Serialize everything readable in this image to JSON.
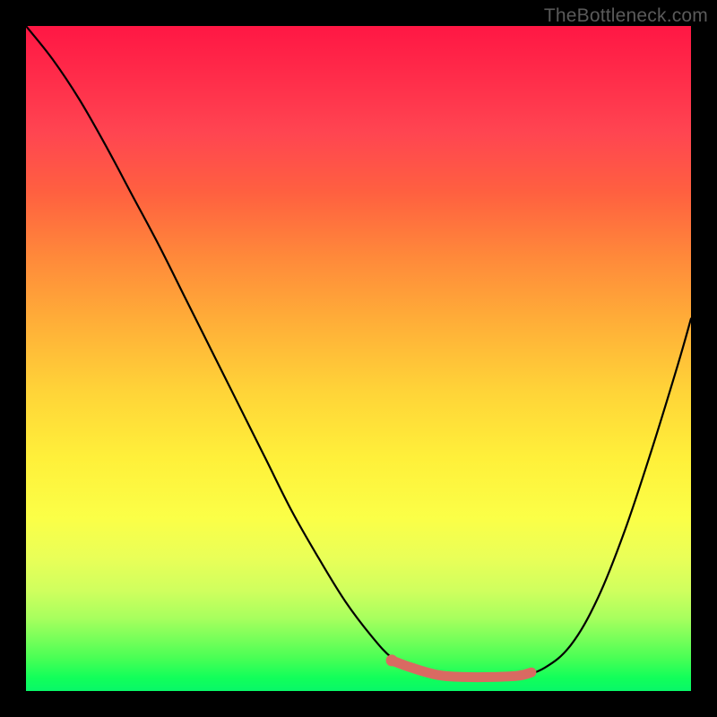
{
  "watermark": "TheBottleneck.com",
  "colors": {
    "background": "#000000",
    "curve_stroke": "#000000",
    "marker_stroke": "#d96a62",
    "marker_fill": "#d96a62",
    "gradient_top": "#ff1744",
    "gradient_bottom": "#08f768"
  },
  "chart_data": {
    "type": "line",
    "title": "",
    "xlabel": "",
    "ylabel": "",
    "xlim": [
      0,
      100
    ],
    "ylim": [
      0,
      100
    ],
    "grid": false,
    "series": [
      {
        "name": "curve",
        "x": [
          0,
          4,
          8,
          12,
          16,
          20,
          24,
          28,
          32,
          36,
          40,
          44,
          48,
          52,
          55,
          58,
          62,
          66,
          70,
          74,
          78,
          82,
          86,
          90,
          94,
          98,
          100
        ],
        "y": [
          100,
          95,
          89,
          82,
          74.5,
          67,
          59,
          51,
          43,
          35,
          27,
          20,
          13.5,
          8.2,
          5,
          3.3,
          2.2,
          2,
          2,
          2.2,
          3.5,
          7,
          14,
          24,
          36,
          49,
          56
        ]
      }
    ],
    "highlight_segment": {
      "name": "optimal-range",
      "x": [
        55,
        58,
        62,
        66,
        70,
        74,
        76
      ],
      "y": [
        4.6,
        3.5,
        2.4,
        2.1,
        2.1,
        2.3,
        2.8
      ]
    },
    "highlight_point": {
      "x": 55,
      "y": 4.6
    }
  }
}
